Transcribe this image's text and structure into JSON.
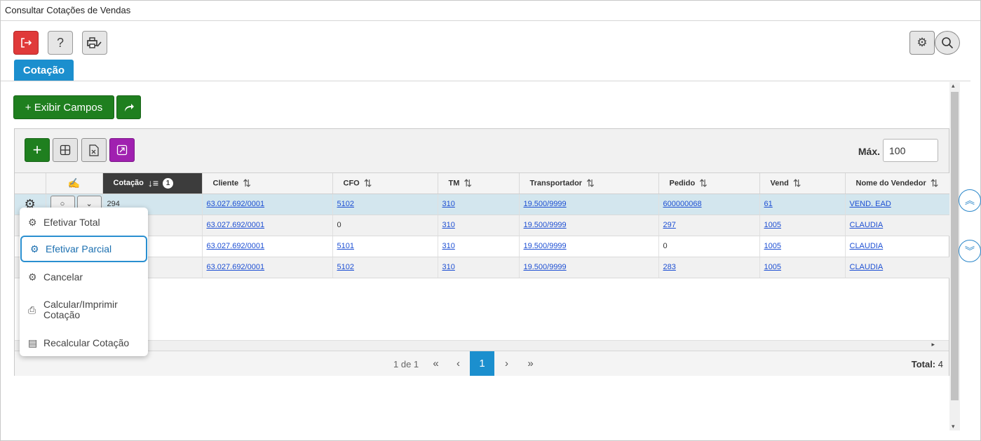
{
  "window": {
    "title": "Consultar Cotações de Vendas"
  },
  "toolbar": {
    "exit_icon": "logout-icon",
    "help_label": "?",
    "print_icon": "print-edit-icon",
    "settings_icon": "gear-icon",
    "search_icon": "search-icon"
  },
  "tabs": [
    {
      "label": "Cotação"
    }
  ],
  "actions": {
    "show_fields_label": "+ Exibir Campos",
    "share_icon": "share-arrow-icon"
  },
  "grid_toolbar": {
    "max_label": "Máx.",
    "max_value": "100"
  },
  "columns": [
    "",
    "",
    "Cotação",
    "Cliente",
    "CFO",
    "TM",
    "Transportador",
    "Pedido",
    "Vend",
    "Nome do Vendedor"
  ],
  "sort": {
    "column": "Cotação",
    "order_badge": "1"
  },
  "rows": [
    {
      "cotacao": "294",
      "cliente": "63.027.692/0001",
      "cfo": "5102",
      "tm": "310",
      "transportador": "19.500/9999",
      "pedido": "600000068",
      "vend": "61",
      "nome": "VEND. EAD",
      "selected": true
    },
    {
      "cotacao": "",
      "cliente": "63.027.692/0001",
      "cfo": "0",
      "tm": "310",
      "transportador": "19.500/9999",
      "pedido": "297",
      "vend": "1005",
      "nome": "CLAUDIA"
    },
    {
      "cotacao": "",
      "cliente": "63.027.692/0001",
      "cfo": "5101",
      "tm": "310",
      "transportador": "19.500/9999",
      "pedido": "0",
      "vend": "1005",
      "nome": "CLAUDIA"
    },
    {
      "cotacao": "",
      "cliente": "63.027.692/0001",
      "cfo": "5102",
      "tm": "310",
      "transportador": "19.500/9999",
      "pedido": "283",
      "vend": "1005",
      "nome": "CLAUDIA"
    }
  ],
  "pager": {
    "info": "1 de 1",
    "current_page": "1",
    "total_label": "Total:",
    "total_value": "4"
  },
  "context_menu": {
    "items": [
      {
        "label": "Efetivar Total",
        "icon": "gear-icon"
      },
      {
        "label": "Efetivar Parcial",
        "icon": "gear-icon",
        "active": true
      },
      {
        "label": "Cancelar",
        "icon": "gear-icon"
      },
      {
        "label": "Calcular/Imprimir Cotação",
        "icon": "print-icon"
      },
      {
        "label": "Recalcular Cotação",
        "icon": "document-icon"
      }
    ]
  },
  "colors": {
    "primary": "#1b8fce",
    "success": "#1f7f1f",
    "danger": "#e03a3a",
    "purple": "#a020b0",
    "link": "#1d4fd3"
  }
}
